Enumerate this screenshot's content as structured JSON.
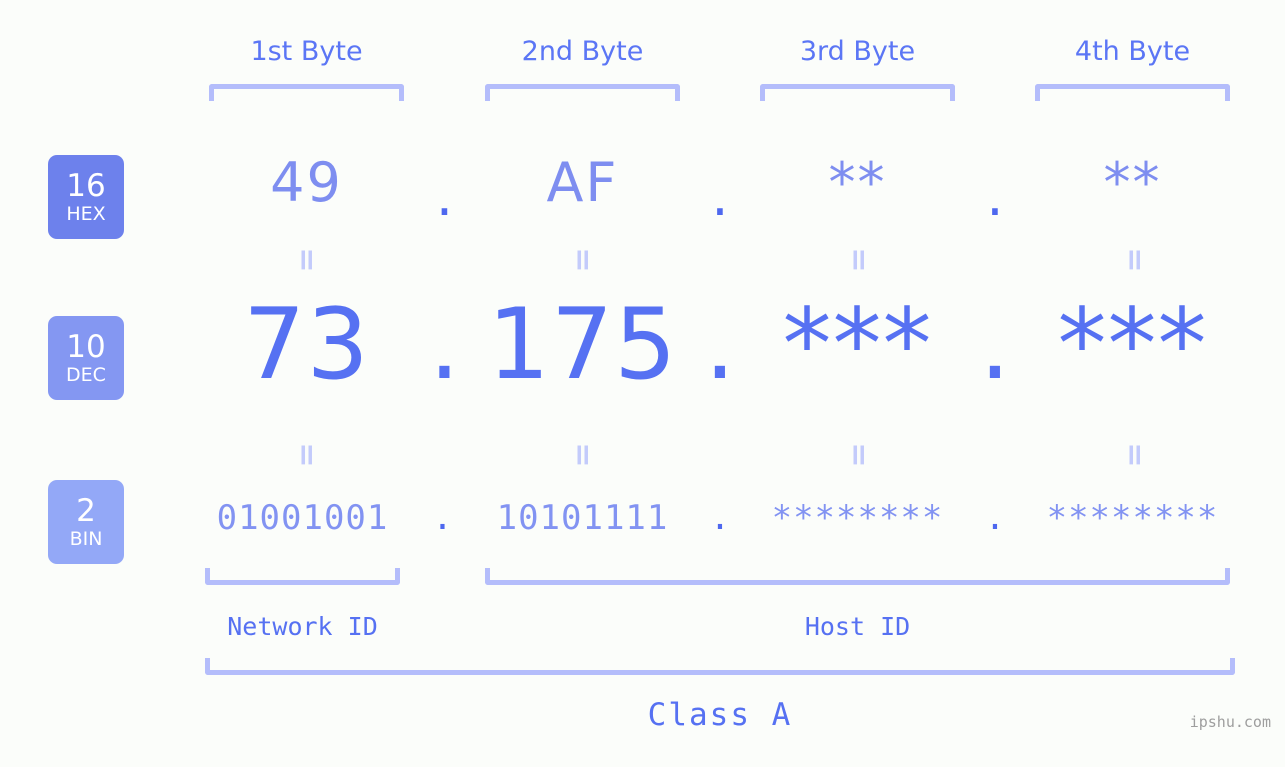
{
  "page": {
    "background_color": "#fbfdfa",
    "accent_color": "#5671f2",
    "accent_light_color": "#b4bdfb",
    "watermark": "ipshu.com"
  },
  "byte_headers": [
    {
      "label": "1st Byte"
    },
    {
      "label": "2nd Byte"
    },
    {
      "label": "3rd Byte"
    },
    {
      "label": "4th Byte"
    }
  ],
  "bases": [
    {
      "number": "16",
      "name": "HEX",
      "color": "#6d81ec"
    },
    {
      "number": "10",
      "name": "DEC",
      "color": "#8497f2"
    },
    {
      "number": "2",
      "name": "BIN",
      "color": "#93a8f7"
    }
  ],
  "rows": {
    "hex": {
      "base_number": "16",
      "base_name": "HEX",
      "values": [
        "49",
        "AF",
        "**",
        "**"
      ],
      "separator": "."
    },
    "dec": {
      "base_number": "10",
      "base_name": "DEC",
      "values": [
        "73",
        "175",
        "***",
        "***"
      ],
      "separator": "."
    },
    "bin": {
      "base_number": "2",
      "base_name": "BIN",
      "values": [
        "01001001",
        "10101111",
        "********",
        "********"
      ],
      "separator": "."
    }
  },
  "equals": {
    "glyph": "="
  },
  "segments": {
    "network_id": "Network ID",
    "host_id": "Host ID"
  },
  "class_label": "Class A"
}
